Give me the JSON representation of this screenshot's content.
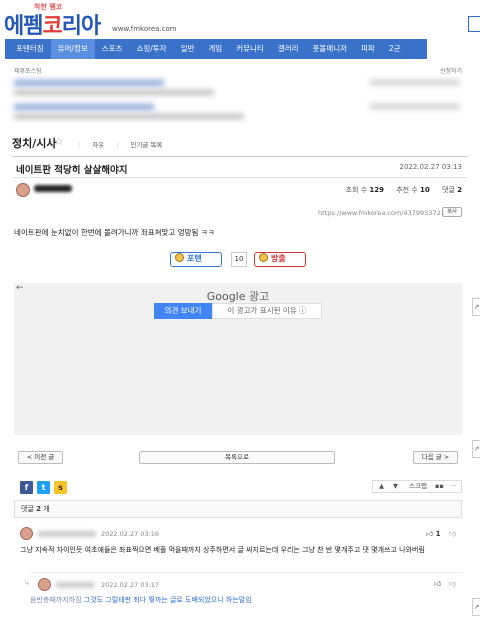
{
  "header": {
    "tagline": "착한 펨코",
    "logo_main": "에펨",
    "logo_red": "코",
    "logo_rest": "리아",
    "url": "www.fmkorea.com"
  },
  "nav": {
    "items": [
      "포텐터짐",
      "유머/정보",
      "스포츠",
      "쇼핑/투자",
      "일반",
      "게임",
      "커뮤니티",
      "갤러리",
      "풋볼매니저",
      "피파",
      "2군"
    ],
    "active_index": 1
  },
  "top_links": {
    "left": "제휴포스팅",
    "right": "신청하기"
  },
  "board": {
    "title": "정치/시사",
    "tabs": [
      "자유",
      "인기글 목록"
    ]
  },
  "post": {
    "title": "네이트판 적당히 살살해야지",
    "date": "2022.02.27 03:13",
    "views_label": "조회 수",
    "views": "129",
    "recommend_label": "추천 수",
    "recommends": "10",
    "comments_label": "댓글",
    "comments": "2",
    "url": "https://www.fmkorea.com/4379933721",
    "copy_label": "복사",
    "body": "네이트판에 눈치없이 한번에 몰려가니까 좌표쳐맞고 엉망됨 ㅋㅋ"
  },
  "vote": {
    "up_label": "포텐",
    "count": "10",
    "down_label": "방출"
  },
  "ad": {
    "google": "Google",
    "ad_label": "광고",
    "feedback": "의견 보내기",
    "why": "이 광고가 표시된 이유 ⓘ"
  },
  "nav_buttons": {
    "prev": "< 이전 글",
    "list": "목록으로",
    "next": "다음 글 >"
  },
  "share": {
    "facebook": "f",
    "twitter": "t",
    "kakao": "s"
  },
  "tools": {
    "up": "▲",
    "down": "▼",
    "scrap": "스크랩",
    "stats": "▪▪",
    "more": "···"
  },
  "comments": {
    "header_prefix": "댓글",
    "count": "2",
    "header_suffix": "개",
    "items": [
      {
        "date": "2022.02.27 03:16",
        "likes": "1",
        "text": "그냥 지속적 차이인듯 여초애들은 좌표찍으면 베플 먹을때까지 상주하면서 글 싸지르는데 우리는 그냥 찬 반 몇개주고 댓 몇개쓰고 나와버림"
      },
      {
        "date": "2022.02.27 03:17",
        "mention": "음반충때까지하짐",
        "text": "그것도 그럴테판 죄다 찢까는 글로 도배되었으니 하는말임"
      }
    ]
  },
  "colors": {
    "brand_blue": "#3a72c9",
    "brand_red": "#e43a3a"
  }
}
